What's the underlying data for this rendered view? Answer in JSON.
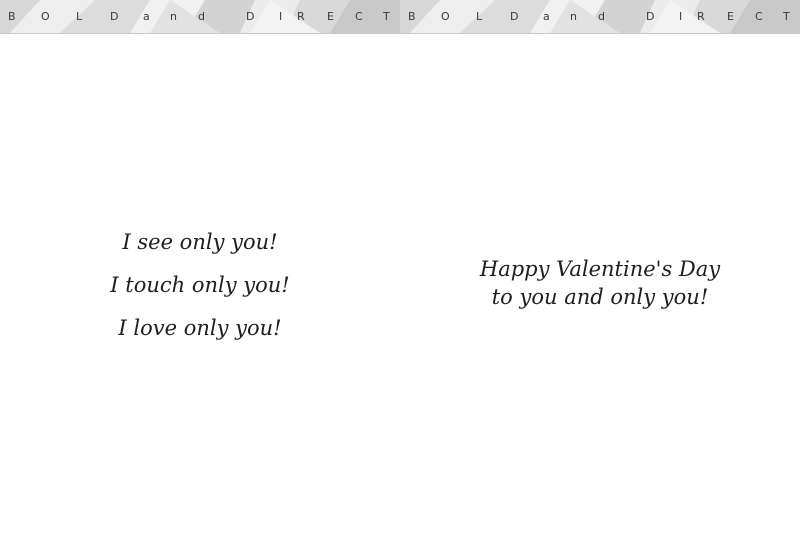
{
  "banner": {
    "letters": [
      "B",
      "O",
      "L",
      "D",
      "a",
      "n",
      "d",
      "D",
      "I",
      "R",
      "E",
      "C",
      "T"
    ]
  },
  "colors": {
    "banner_bg": "#e6e6e6",
    "text": "#1e1e1e"
  },
  "left_panel": {
    "lines": [
      "I see only you!",
      "I touch only you!",
      "I love only you!"
    ]
  },
  "right_panel": {
    "lines": [
      "Happy Valentine's Day",
      "to you and only you!"
    ]
  }
}
